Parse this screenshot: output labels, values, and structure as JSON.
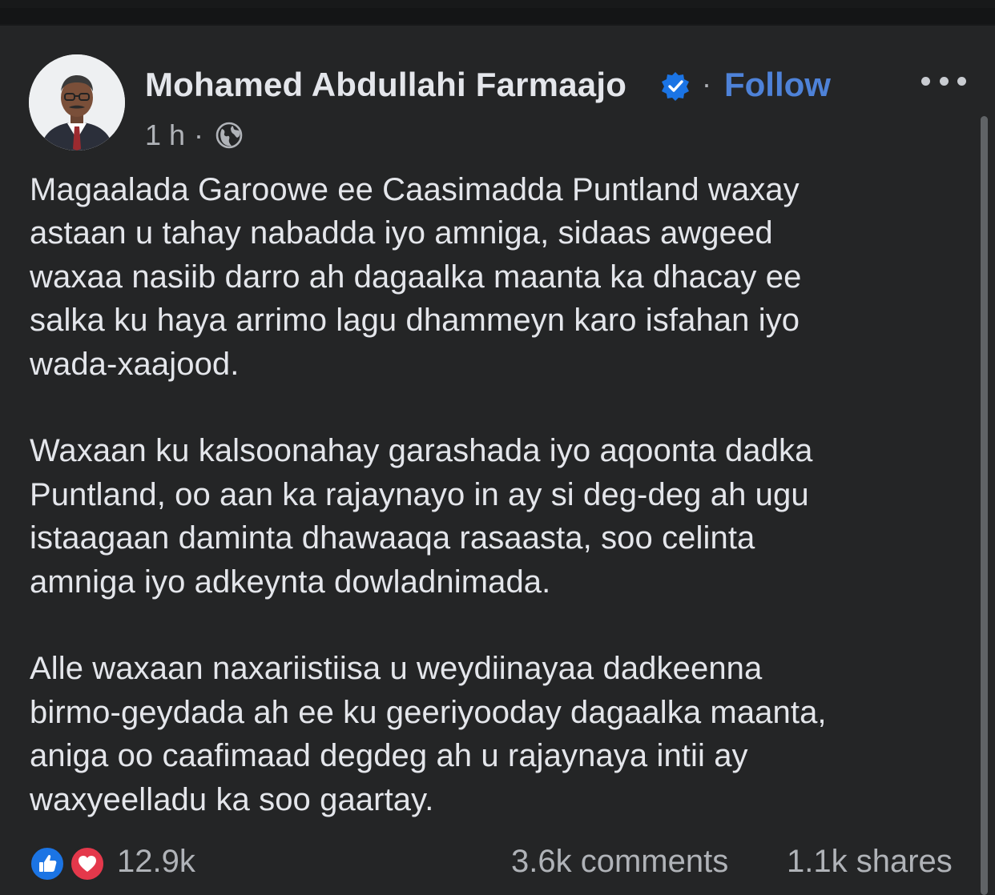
{
  "colors": {
    "background": "#242526",
    "text_primary": "#e4e6eb",
    "text_secondary": "#b0b3b8",
    "follow": "#4e82d8",
    "verified": "#1b74e4",
    "like": "#1b74e4",
    "love": "#e4384b"
  },
  "post": {
    "author": "Mohamed Abdullahi Farmaajo",
    "verified_icon": "verified-badge-icon",
    "separator": "·",
    "follow_label": "Follow",
    "time": "1 h",
    "time_separator": "·",
    "audience_icon": "globe-icon",
    "more_icon": "more-options-icon",
    "body": "Magaalada Garoowe ee Caasimadda Puntland waxay\nastaan u tahay nabadda iyo amniga, sidaas awgeed\nwaxaa nasiib darro ah dagaalka maanta ka dhacay ee\nsalka ku haya arrimo lagu dhammeyn karo isfahan iyo\nwada-xaajood.\n\nWaxaan ku kalsoonahay garashada iyo aqoonta dadka\nPuntland, oo aan ka rajaynayo in ay si deg-deg ah ugu\nistaagaan daminta dhawaaqa rasaasta, soo celinta\namniga iyo adkeynta dowladnimada.\n\nAlle waxaan naxariistiisa u weydiinayaa dadkeenna\nbirmo-geydada ah ee ku geeriyooday dagaalka maanta,\naniga oo caafimaad degdeg ah u rajaynaya intii ay\nwaxyeelladu ka soo gaartay."
  },
  "footer": {
    "reaction_icons": [
      "like-icon",
      "love-icon"
    ],
    "reaction_count": "12.9k",
    "comments": "3.6k comments",
    "shares": "1.1k shares"
  }
}
